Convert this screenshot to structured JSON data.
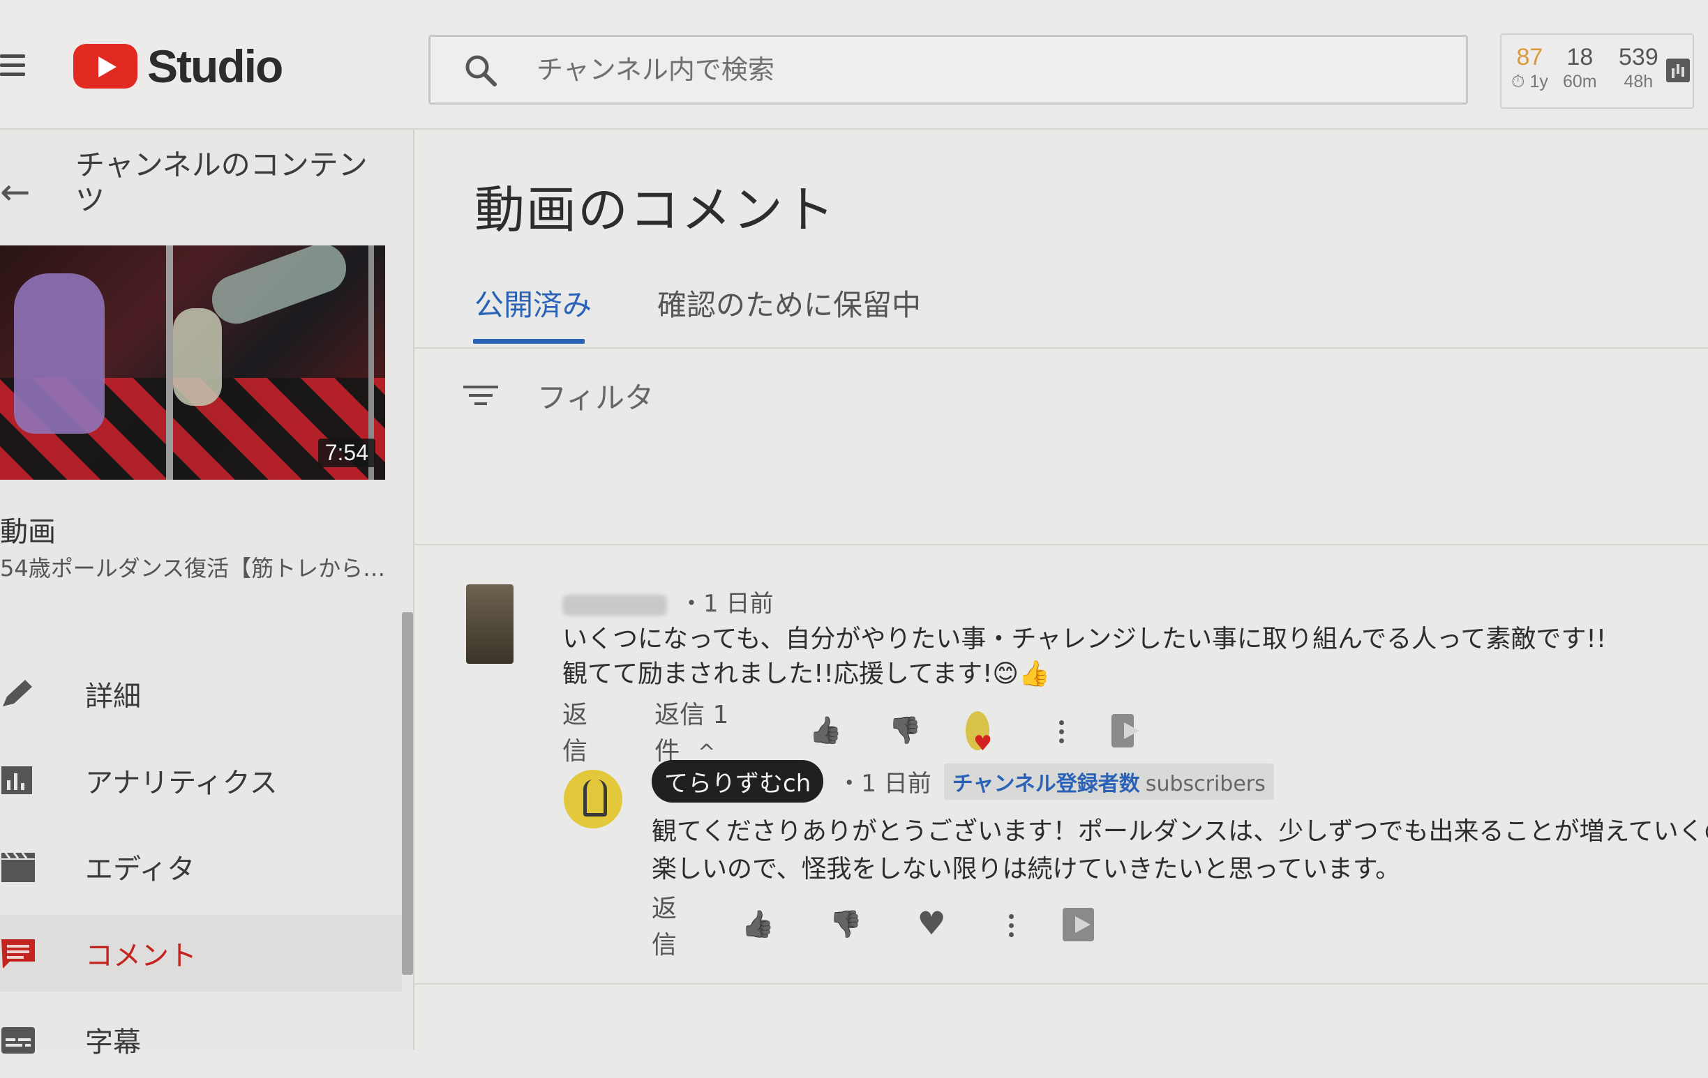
{
  "header": {
    "logo_text": "Studio",
    "search_placeholder": "チャンネル内で検索",
    "stats": [
      {
        "value": "87",
        "label": "⏱ 1y"
      },
      {
        "value": "18",
        "label": "60m"
      },
      {
        "value": "539",
        "label": "48h"
      }
    ]
  },
  "sidebar": {
    "back_icon": "←",
    "channel_content_title": "チャンネルのコンテンツ",
    "video_duration": "7:54",
    "video_section_label": "動画",
    "video_title": "54歳ポールダンス復活【筋トレから…",
    "items": [
      {
        "label": "詳細",
        "icon": "pencil-icon"
      },
      {
        "label": "アナリティクス",
        "icon": "analytics-icon"
      },
      {
        "label": "エディタ",
        "icon": "clapperboard-icon"
      },
      {
        "label": "コメント",
        "icon": "comment-icon",
        "active": true
      },
      {
        "label": "字幕",
        "icon": "subtitles-icon"
      }
    ]
  },
  "main": {
    "page_title": "動画のコメント",
    "tabs": [
      {
        "label": "公開済み",
        "active": true
      },
      {
        "label": "確認のために保留中"
      }
    ],
    "filter_label": "フィルタ",
    "comment": {
      "time": "・1 日前",
      "text_line1": "いくつになっても、自分がやりたい事・チャレンジしたい事に取り組んでる人って素敵です!!",
      "text_line2": "観てて励まされました!!応援してます!😊👍",
      "reply_label": "返信",
      "replies_count_label": "返信 1 件",
      "chevron": "^"
    },
    "reply": {
      "author": "てらりずむch",
      "time": "・1 日前",
      "badge_blue": "チャンネル登録者数",
      "badge_grey": "subscribers",
      "text_line1": "観てくださりありがとうございます！ポールダンスは、少しずつでも出来ることが増えていくのがと",
      "text_line2": "楽しいので、怪我をしない限りは続けていきたいと思っています。",
      "reply_label": "返信"
    }
  },
  "colors": {
    "accent_blue": "#2a62b8",
    "youtube_red": "#e22a23",
    "active_nav_red": "#c3241f"
  }
}
